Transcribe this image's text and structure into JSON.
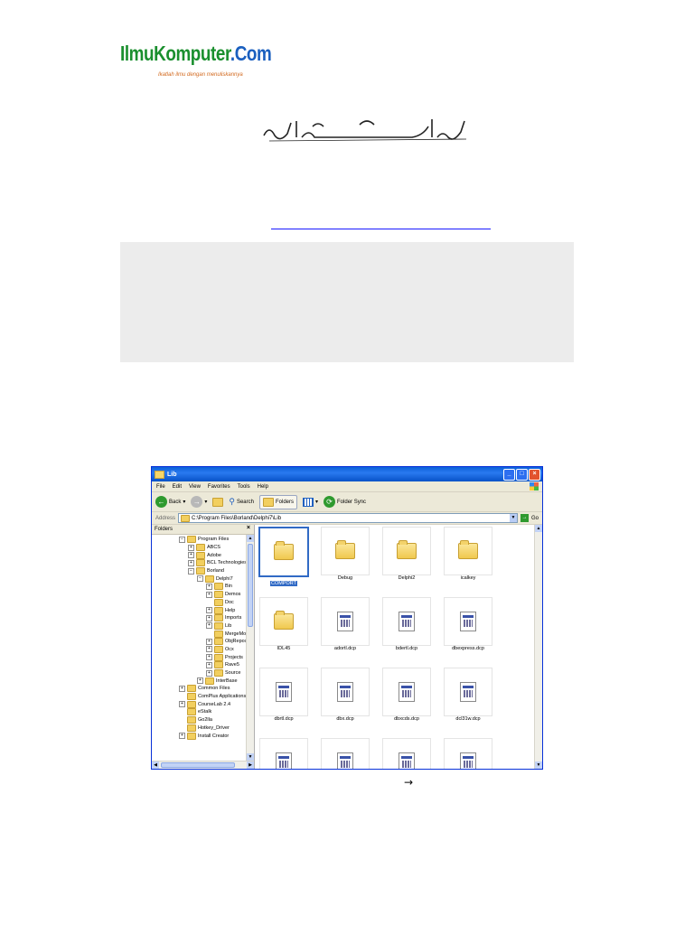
{
  "logo": {
    "brand_ilmu": "IlmuKomputer",
    "brand_dot": ".Com",
    "tagline": "Ikatlah ilmu dengan menuliskannya"
  },
  "window": {
    "title": "Lib",
    "menu": [
      "File",
      "Edit",
      "View",
      "Favorites",
      "Tools",
      "Help"
    ],
    "toolbar": {
      "back": "Back",
      "search": "Search",
      "folders": "Folders",
      "folder_sync": "Folder Sync"
    },
    "address_label": "Address",
    "address_value": "C:\\Program Files\\Borland\\Delphi7\\Lib",
    "go": "Go",
    "folders_pane_title": "Folders",
    "tree": [
      {
        "label": "Program Files",
        "indent": 0,
        "pm": "-"
      },
      {
        "label": "ABCS",
        "indent": 1,
        "pm": "+"
      },
      {
        "label": "Adobe",
        "indent": 1,
        "pm": "+"
      },
      {
        "label": "BCL Technologies",
        "indent": 1,
        "pm": "+"
      },
      {
        "label": "Borland",
        "indent": 1,
        "pm": "-"
      },
      {
        "label": "Delphi7",
        "indent": 2,
        "pm": "-"
      },
      {
        "label": "Bin",
        "indent": 3,
        "pm": "+"
      },
      {
        "label": "Demos",
        "indent": 3,
        "pm": "+"
      },
      {
        "label": "Doc",
        "indent": 3,
        "pm": ""
      },
      {
        "label": "Help",
        "indent": 3,
        "pm": "+"
      },
      {
        "label": "Imports",
        "indent": 3,
        "pm": "+"
      },
      {
        "label": "Lib",
        "indent": 3,
        "pm": "+"
      },
      {
        "label": "MergeMod",
        "indent": 3,
        "pm": ""
      },
      {
        "label": "ObjRepos",
        "indent": 3,
        "pm": "+"
      },
      {
        "label": "Ocx",
        "indent": 3,
        "pm": "+"
      },
      {
        "label": "Projects",
        "indent": 3,
        "pm": "+"
      },
      {
        "label": "Rave5",
        "indent": 3,
        "pm": "+"
      },
      {
        "label": "Source",
        "indent": 3,
        "pm": "+"
      },
      {
        "label": "InterBase",
        "indent": 2,
        "pm": "+"
      },
      {
        "label": "Common Files",
        "indent": 0,
        "pm": "+"
      },
      {
        "label": "ComPlus Applications",
        "indent": 0,
        "pm": ""
      },
      {
        "label": "CourseLab 2.4",
        "indent": 0,
        "pm": "+"
      },
      {
        "label": "eStalk",
        "indent": 0,
        "pm": ""
      },
      {
        "label": "Go2lla",
        "indent": 0,
        "pm": ""
      },
      {
        "label": "Hotkey_Driver",
        "indent": 0,
        "pm": ""
      },
      {
        "label": "Install Creator",
        "indent": 0,
        "pm": "+"
      }
    ],
    "files": [
      {
        "name": "COMPORT",
        "kind": "folder",
        "selected": true
      },
      {
        "name": "Debug",
        "kind": "folder"
      },
      {
        "name": "Delphi2",
        "kind": "folder"
      },
      {
        "name": "icalkey",
        "kind": "folder"
      },
      {
        "name": "IDL45",
        "kind": "folder"
      },
      {
        "name": "adortl.dcp",
        "kind": "dcp"
      },
      {
        "name": "bdertl.dcp",
        "kind": "dcp"
      },
      {
        "name": "dbexpress.dcp",
        "kind": "dcp"
      },
      {
        "name": "dbrtl.dcp",
        "kind": "dcp"
      },
      {
        "name": "dbx.dcp",
        "kind": "dcp"
      },
      {
        "name": "dbxcds.dcp",
        "kind": "dcp"
      },
      {
        "name": "dcl31w.dcp",
        "kind": "dcp"
      },
      {
        "name": "",
        "kind": "dcp"
      },
      {
        "name": "",
        "kind": "dcp"
      },
      {
        "name": "",
        "kind": "dcp"
      },
      {
        "name": "",
        "kind": "dcp"
      }
    ]
  },
  "caption_arrow": "→"
}
